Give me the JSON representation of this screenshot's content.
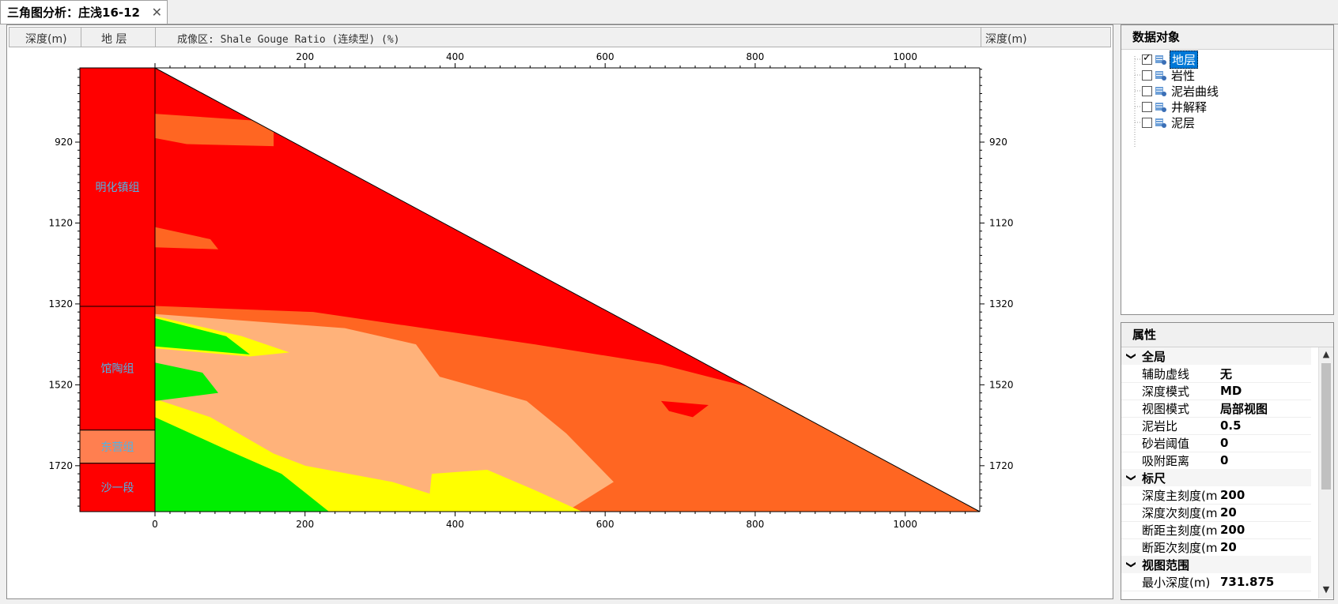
{
  "tab": {
    "title": "三角图分析：庄浅16-12",
    "close": "✕"
  },
  "header": {
    "depth_left": "深度(m)",
    "strata": "地 层",
    "imaging": "成像区: Shale Gouge Ratio (连续型) (%)",
    "depth_right": "深度(m)"
  },
  "axes": {
    "x_ticks": [
      "200",
      "400",
      "600",
      "800",
      "1000"
    ],
    "x_bottom_ticks": [
      "0",
      "200",
      "400",
      "600",
      "800",
      "1000"
    ],
    "y_ticks": [
      "920",
      "1120",
      "1320",
      "1520",
      "1720"
    ]
  },
  "formations": [
    {
      "name": "明化镇组"
    },
    {
      "name": "馆陶组"
    },
    {
      "name": "东营组"
    },
    {
      "name": "沙一段"
    }
  ],
  "colors": {
    "red": "#ff0000",
    "orange": "#ff6622",
    "light_orange": "#ffb27a",
    "yellow": "#ffff00",
    "green": "#00ee00",
    "formation_label": "#4fb3e6",
    "dongying": "#ff7f50"
  },
  "data_objects": {
    "title": "数据对象",
    "items": [
      {
        "label": "地层",
        "checked": true,
        "selected": true
      },
      {
        "label": "岩性",
        "checked": false
      },
      {
        "label": "泥岩曲线",
        "checked": false
      },
      {
        "label": "井解释",
        "checked": false
      },
      {
        "label": "泥层",
        "checked": false
      }
    ]
  },
  "properties": {
    "title": "属性",
    "categories": [
      {
        "name": "全局",
        "rows": [
          {
            "k": "辅助虚线",
            "v": "无"
          },
          {
            "k": "深度模式",
            "v": "MD"
          },
          {
            "k": "视图模式",
            "v": "局部视图"
          },
          {
            "k": "泥岩比",
            "v": "0.5"
          },
          {
            "k": "砂岩阈值",
            "v": "0"
          },
          {
            "k": "吸附距离",
            "v": "0"
          }
        ]
      },
      {
        "name": "标尺",
        "rows": [
          {
            "k": "深度主刻度(m)",
            "v": "200"
          },
          {
            "k": "深度次刻度(m)",
            "v": "20"
          },
          {
            "k": "断距主刻度(m)",
            "v": "200"
          },
          {
            "k": "断距次刻度(m)",
            "v": "20"
          }
        ]
      },
      {
        "name": "视图范围",
        "rows": [
          {
            "k": "最小深度(m)",
            "v": "731.875"
          }
        ]
      }
    ]
  }
}
